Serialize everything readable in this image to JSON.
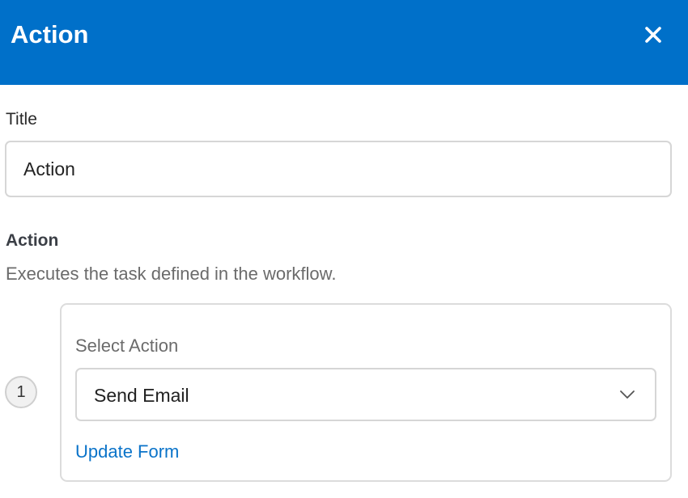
{
  "header": {
    "title": "Action",
    "close_icon": "close-icon",
    "background_color": "#0070c9"
  },
  "title_field": {
    "label": "Title",
    "value": "Action"
  },
  "action_section": {
    "heading": "Action",
    "description": "Executes the task defined in the workflow."
  },
  "steps": [
    {
      "number": "1",
      "select_label": "Select Action",
      "selected_action": "Send Email",
      "dropdown_icon": "chevron-down-icon",
      "link_label": "Update Form",
      "link_color": "#0a73c9"
    }
  ]
}
